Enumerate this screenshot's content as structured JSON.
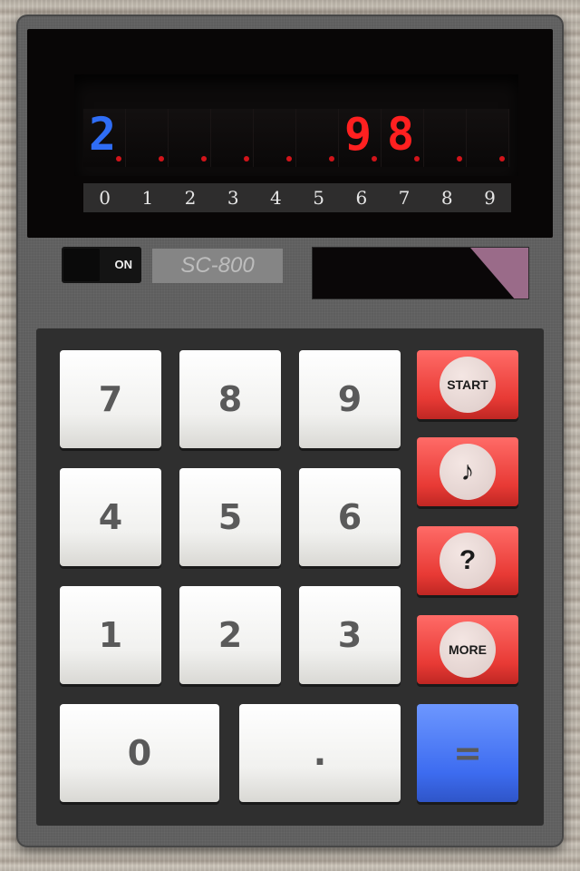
{
  "display": {
    "digits": [
      {
        "value": "2",
        "color": "#2f6df5"
      },
      {
        "value": "",
        "color": "#ff2020"
      },
      {
        "value": "",
        "color": "#ff2020"
      },
      {
        "value": "",
        "color": "#ff2020"
      },
      {
        "value": "",
        "color": "#ff2020"
      },
      {
        "value": "",
        "color": "#ff2020"
      },
      {
        "value": "9",
        "color": "#ff2020"
      },
      {
        "value": "8",
        "color": "#ff2020"
      },
      {
        "value": "",
        "color": "#ff2020"
      },
      {
        "value": "",
        "color": "#ff2020"
      }
    ],
    "dot_color": "#d2141a",
    "index_labels": [
      "0",
      "1",
      "2",
      "3",
      "4",
      "5",
      "6",
      "7",
      "8",
      "9"
    ]
  },
  "power_switch": {
    "label": "ON"
  },
  "model_name": "SC-800",
  "keys": {
    "k7": "7",
    "k8": "8",
    "k9": "9",
    "k4": "4",
    "k5": "5",
    "k6": "6",
    "k1": "1",
    "k2": "2",
    "k3": "3",
    "k0": "0",
    "dot": ".",
    "equals": "="
  },
  "side_buttons": {
    "start": "START",
    "music": "♪",
    "help": "?",
    "more": "MORE"
  },
  "colors": {
    "body": "#5e5e5e",
    "red_key": "#e83a35",
    "blue_key": "#3d6cf0",
    "solar_accent": "#9a6b89"
  }
}
